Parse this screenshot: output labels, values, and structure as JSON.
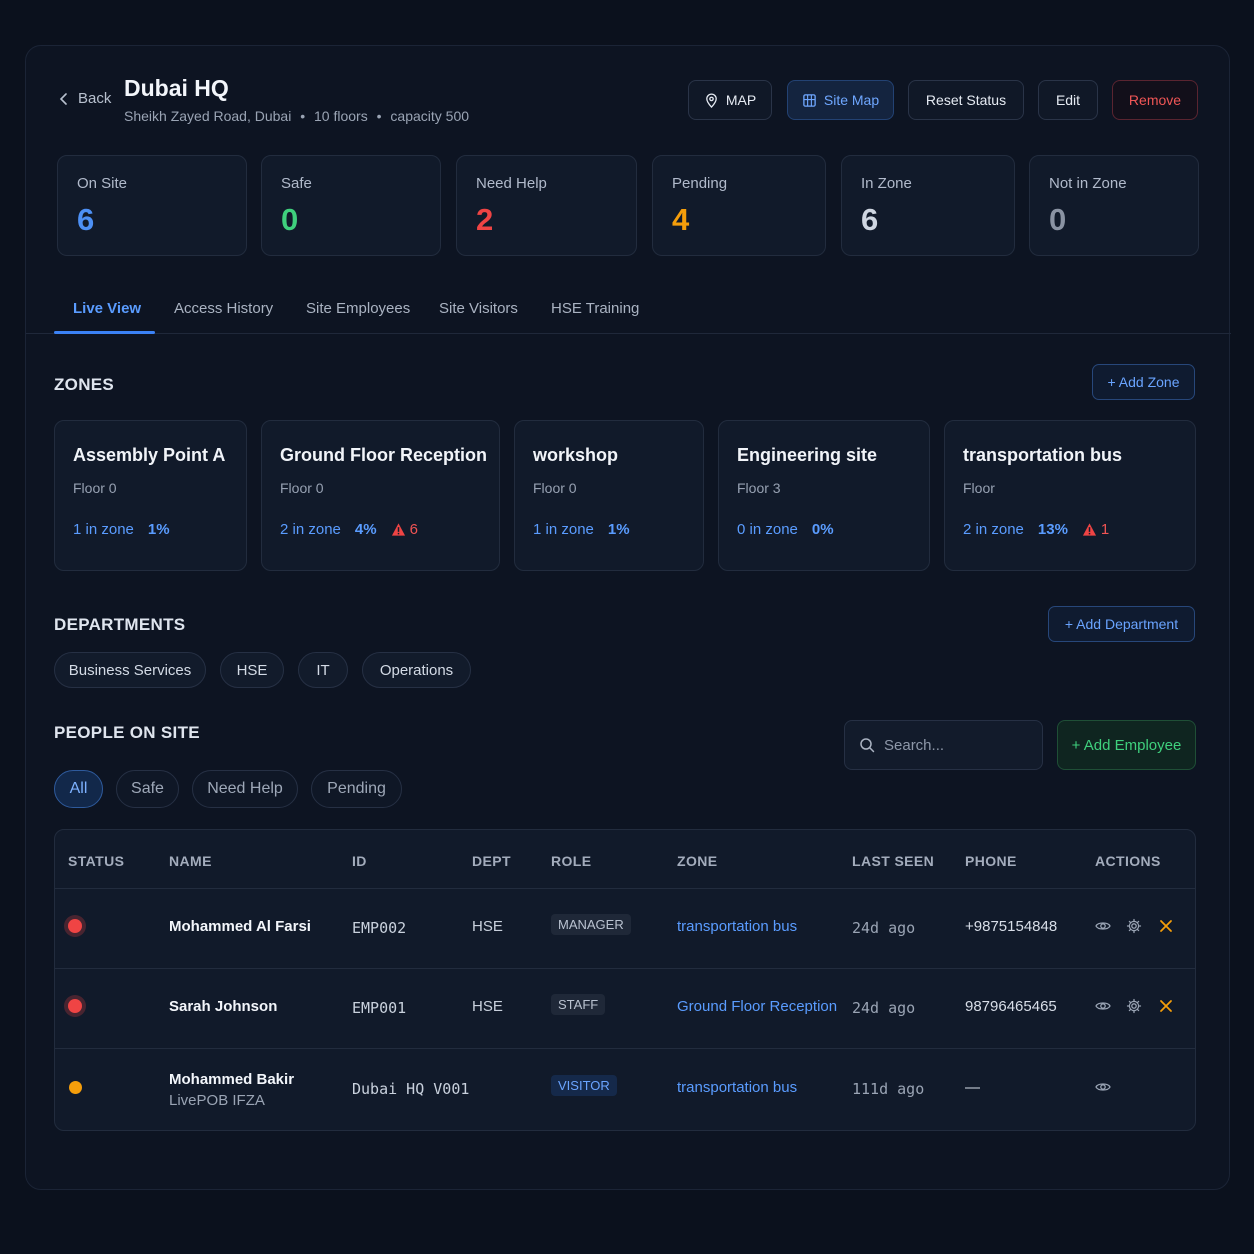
{
  "header": {
    "back_label": "Back",
    "title": "Dubai HQ",
    "address": "Sheikh Zayed Road, Dubai",
    "floors": "10 floors",
    "capacity": "capacity 500",
    "separator": "•",
    "buttons": {
      "map": "MAP",
      "site_map": "Site Map",
      "reset": "Reset Status",
      "edit": "Edit",
      "remove": "Remove"
    }
  },
  "stats": [
    {
      "label": "On Site",
      "value": "6",
      "color": "#4d90f5"
    },
    {
      "label": "Safe",
      "value": "0",
      "color": "#3fd07d"
    },
    {
      "label": "Need Help",
      "value": "2",
      "color": "#ef4444"
    },
    {
      "label": "Pending",
      "value": "4",
      "color": "#f59e0b"
    },
    {
      "label": "In Zone",
      "value": "6",
      "color": "#cfd6e1"
    },
    {
      "label": "Not in Zone",
      "value": "0",
      "color": "#8a93a3"
    }
  ],
  "tabs": [
    "Live View",
    "Access History",
    "Site Employees",
    "Site Visitors",
    "HSE Training"
  ],
  "zones_section": {
    "title": "ZONES",
    "add_label": "+ Add Zone",
    "zones": [
      {
        "name": "Assembly Point A",
        "floor": "Floor 0",
        "in_zone": "1 in zone",
        "pct": "1%",
        "alerts": ""
      },
      {
        "name": "Ground Floor Reception",
        "floor": "Floor 0",
        "in_zone": "2 in zone",
        "pct": "4%",
        "alerts": "6"
      },
      {
        "name": "workshop",
        "floor": "Floor 0",
        "in_zone": "1 in zone",
        "pct": "1%",
        "alerts": ""
      },
      {
        "name": "Engineering site",
        "floor": "Floor 3",
        "in_zone": "0 in zone",
        "pct": "0%",
        "alerts": ""
      },
      {
        "name": "transportation bus",
        "floor": "Floor",
        "in_zone": "2 in zone",
        "pct": "13%",
        "alerts": "1"
      }
    ]
  },
  "departments_section": {
    "title": "DEPARTMENTS",
    "add_label": "+ Add Department",
    "items": [
      "Business Services",
      "HSE",
      "IT",
      "Operations"
    ]
  },
  "people_section": {
    "title": "PEOPLE ON SITE",
    "search_placeholder": "Search...",
    "add_label": "+ Add Employee",
    "filters": [
      "All",
      "Safe",
      "Need Help",
      "Pending"
    ],
    "columns": [
      "STATUS",
      "NAME",
      "ID",
      "DEPT",
      "ROLE",
      "ZONE",
      "LAST SEEN",
      "PHONE",
      "ACTIONS"
    ],
    "rows": [
      {
        "status": "need-help",
        "name": "Mohammed Al Farsi",
        "sub": "",
        "id": "EMP002",
        "dept": "HSE",
        "role": "MANAGER",
        "zone": "transportation bus",
        "last_seen": "24d ago",
        "phone": "+9875154848"
      },
      {
        "status": "need-help",
        "name": "Sarah Johnson",
        "sub": "",
        "id": "EMP001",
        "dept": "HSE",
        "role": "STAFF",
        "zone": "Ground Floor Reception",
        "last_seen": "24d ago",
        "phone": "98796465465"
      },
      {
        "status": "pending",
        "name": "Mohammed Bakir",
        "sub": "LivePOB IFZA",
        "id": "Dubai HQ V001",
        "dept": "",
        "role": "VISITOR",
        "zone": "transportation bus",
        "last_seen": "111d ago",
        "phone": "—"
      }
    ]
  },
  "icons": {
    "back": "chevron-left-icon",
    "map": "map-pin-icon",
    "site_map": "building-icon",
    "alert": "warning-triangle-icon",
    "search": "search-icon",
    "view": "eye-icon",
    "settings": "gear-icon",
    "remove": "close-icon"
  },
  "colors": {
    "accent": "#3b82f6",
    "danger": "#ef4444",
    "warning": "#f59e0b",
    "success": "#3fd07d"
  }
}
